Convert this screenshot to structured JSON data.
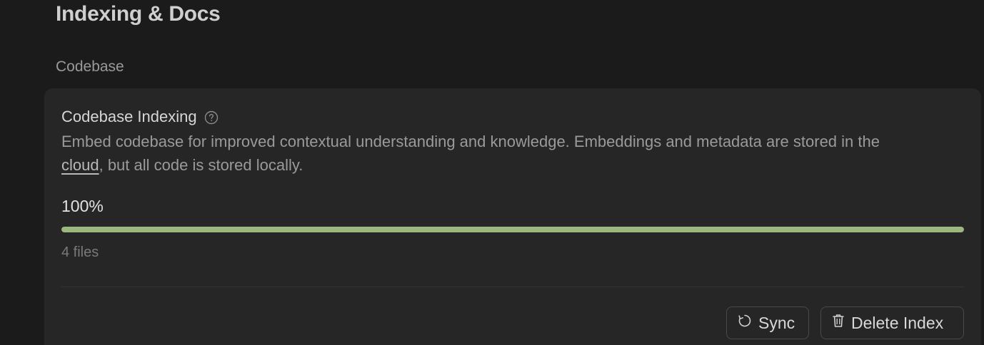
{
  "header": {
    "title": "Indexing & Docs"
  },
  "section": {
    "label": "Codebase"
  },
  "card": {
    "title": "Codebase Indexing",
    "help_icon": "question-circle-icon",
    "description_before": "Embed codebase for improved contextual understanding and knowledge. Embeddings and metadata are stored in the ",
    "description_link": "cloud",
    "description_after": ", but all code is stored locally.",
    "progress": {
      "percent_label": "100%",
      "fraction": 1.0,
      "color": "#9bb881"
    },
    "files_label": "4 files",
    "buttons": {
      "sync_label": "Sync",
      "sync_icon": "refresh-icon",
      "delete_label": "Delete Index",
      "delete_icon": "trash-icon"
    }
  }
}
